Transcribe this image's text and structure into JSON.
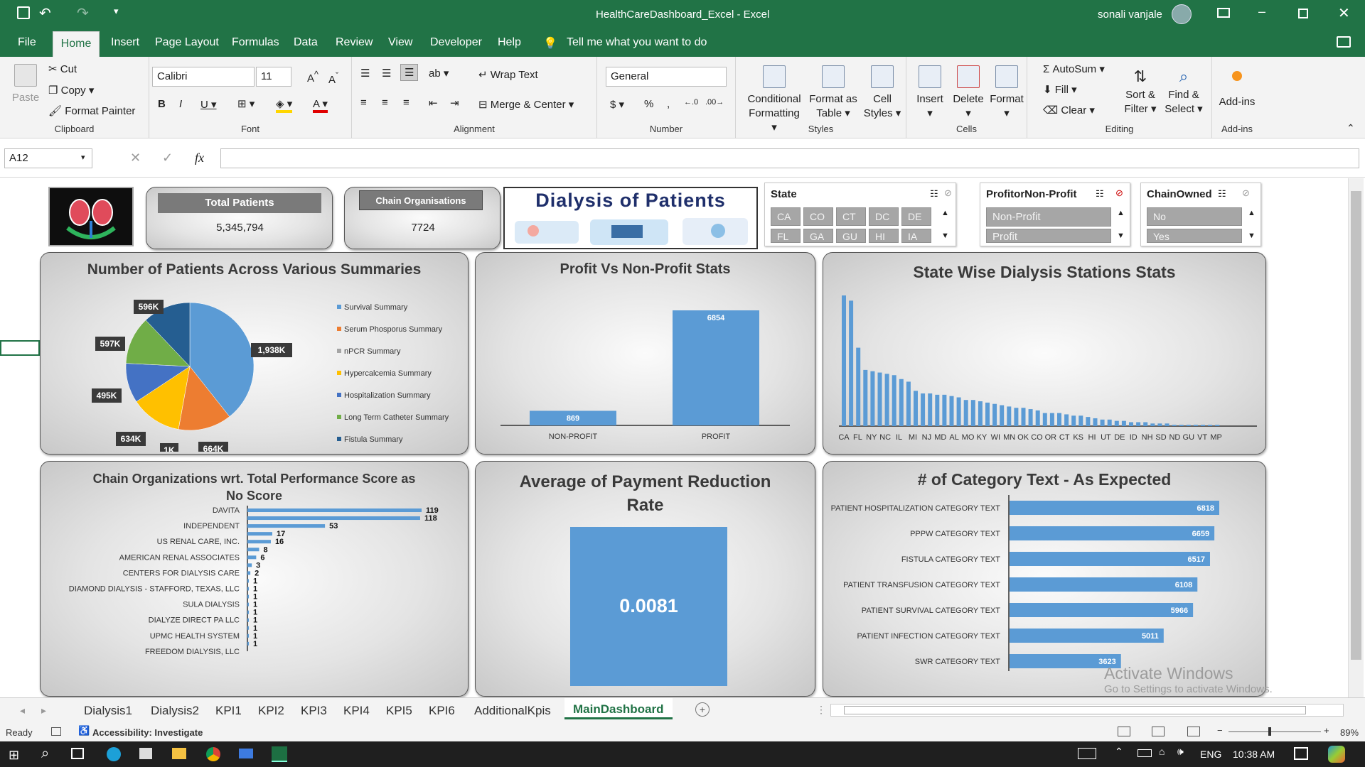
{
  "window": {
    "title": "HealthCareDashboard_Excel  -  Excel",
    "user": "sonali vanjale"
  },
  "menu": {
    "tabs": [
      "File",
      "Home",
      "Insert",
      "Page Layout",
      "Formulas",
      "Data",
      "Review",
      "View",
      "Developer",
      "Help"
    ],
    "tell_me": "Tell me what you want to do"
  },
  "ribbon": {
    "clipboard": {
      "paste": "Paste",
      "cut": "Cut",
      "copy": "Copy",
      "format_painter": "Format Painter",
      "label": "Clipboard"
    },
    "font": {
      "name": "Calibri",
      "size": "11",
      "label": "Font"
    },
    "alignment": {
      "wrap": "Wrap Text",
      "merge": "Merge & Center",
      "label": "Alignment"
    },
    "number": {
      "format": "General",
      "label": "Number"
    },
    "styles": {
      "cond_1": "Conditional",
      "cond_2": "Formatting",
      "fmt_1": "Format as",
      "fmt_2": "Table",
      "cell_1": "Cell",
      "cell_2": "Styles",
      "label": "Styles"
    },
    "cells": {
      "insert": "Insert",
      "delete": "Delete",
      "format": "Format",
      "label": "Cells"
    },
    "editing": {
      "autosum": "AutoSum",
      "fill": "Fill",
      "clear": "Clear",
      "sort_1": "Sort &",
      "sort_2": "Filter",
      "find_1": "Find &",
      "find_2": "Select",
      "label": "Editing"
    },
    "addins": {
      "btn": "Add-ins",
      "label": "Add-ins"
    }
  },
  "formula_bar": {
    "name_box": "A12",
    "fx": "fx",
    "value": ""
  },
  "dashboard": {
    "total_patients": {
      "label": "Total Patients",
      "value": "5,345,794"
    },
    "chain_orgs": {
      "label": "Chain Organisations",
      "value": "7724"
    },
    "banner_title": "Dialysis of Patients",
    "slicers": {
      "state": {
        "title": "State",
        "items": [
          "CA",
          "CO",
          "CT",
          "DC",
          "DE",
          "FL",
          "GA",
          "GU",
          "HI",
          "IA"
        ]
      },
      "profit": {
        "title": "ProfitorNon-Profit",
        "items": [
          "Non-Profit",
          "Profit"
        ]
      },
      "chain": {
        "title": "ChainOwned",
        "items": [
          "No",
          "Yes"
        ]
      }
    },
    "pie": {
      "title": "Number of Patients Across Various Summaries",
      "labels": [
        "1,938K",
        "664K",
        "1K",
        "634K",
        "495K",
        "597K",
        "596K"
      ]
    },
    "profit_chart": {
      "title": "Profit Vs Non-Profit Stats"
    },
    "state_chart": {
      "title": "State Wise Dialysis Stations Stats"
    },
    "chain_perf": {
      "title_1": "Chain Organizations wrt. Total Performance Score as",
      "title_2": "No Score"
    },
    "payment": {
      "title_1": "Average of Payment Reduction",
      "title_2": "Rate",
      "value": "0.0081"
    },
    "category": {
      "title": "# of Category Text  - As Expected"
    }
  },
  "chart_data": [
    {
      "type": "pie",
      "title": "Number of Patients Across Various Summaries",
      "categories": [
        "Survival Summary",
        "Serum Phosporus Summary",
        "nPCR Summary",
        "Hypercalcemia Summary",
        "Hospitalization Summary",
        "Long Term Catheter Summary",
        "Fistula Summary"
      ],
      "values": [
        1938,
        664,
        1,
        634,
        495,
        597,
        596
      ],
      "colors": [
        "#5b9bd5",
        "#ed7d31",
        "#a5a5a5",
        "#ffc000",
        "#4472c4",
        "#70ad47",
        "#255e91"
      ],
      "legend": "right"
    },
    {
      "type": "bar",
      "title": "Profit Vs Non-Profit Stats",
      "categories": [
        "NON-PROFIT",
        "PROFIT"
      ],
      "values": [
        869,
        6854
      ]
    },
    {
      "type": "bar",
      "title": "State Wise Dialysis Stations Stats",
      "categories": [
        "CA",
        "FL",
        "NY",
        "NC",
        "IL",
        "MI",
        "NJ",
        "MD",
        "AL",
        "MO",
        "KY",
        "WI",
        "MN",
        "OK",
        "CO",
        "OR",
        "CT",
        "KS",
        "HI",
        "UT",
        "DE",
        "ID",
        "NH",
        "SD",
        "ND",
        "GU",
        "VT",
        "MP"
      ],
      "values": [
        100,
        96,
        60,
        43,
        42,
        41,
        40,
        39,
        36,
        34,
        27,
        25,
        25,
        24,
        24,
        23,
        22,
        20,
        20,
        19,
        18,
        17,
        16,
        15,
        14,
        14,
        13,
        12,
        10,
        10,
        10,
        9,
        8,
        8,
        7,
        6,
        5,
        5,
        4,
        4,
        3,
        3,
        3,
        2,
        2,
        2,
        1,
        1,
        1,
        1,
        1,
        1,
        1
      ],
      "grid": false
    },
    {
      "type": "bar",
      "title": "Chain Organizations wrt. Total Performance Score as No Score",
      "categories": [
        "DAVITA",
        "INDEPENDENT",
        "US RENAL CARE, INC.",
        "AMERICAN RENAL ASSOCIATES",
        "CENTERS FOR DIALYSIS CARE",
        "DIAMOND DIALYSIS - STAFFORD, TEXAS, LLC",
        "SULA DIALYSIS",
        "DIALYZE DIRECT PA LLC",
        "UPMC HEALTH SYSTEM",
        "FREEDOM DIALYSIS, LLC"
      ],
      "values": [
        119,
        118,
        53,
        17,
        16,
        8,
        6,
        3,
        2,
        1,
        1,
        1,
        1,
        1,
        1,
        1,
        1,
        1
      ]
    },
    {
      "type": "bar",
      "title": "Average of Payment Reduction Rate",
      "categories": [
        ""
      ],
      "values": [
        0.0081
      ]
    },
    {
      "type": "bar",
      "title": "# of Category Text  - As Expected",
      "categories": [
        "PATIENT HOSPITALIZATION CATEGORY TEXT",
        "PPPW CATEGORY TEXT",
        "FISTULA CATEGORY TEXT",
        "PATIENT TRANSFUSION CATEGORY TEXT",
        "PATIENT SURVIVAL CATEGORY TEXT",
        "PATIENT INFECTION CATEGORY TEXT",
        "SWR CATEGORY TEXT"
      ],
      "values": [
        6818,
        6659,
        6517,
        6108,
        5966,
        5011,
        3623
      ]
    }
  ],
  "sheet_tabs": [
    "Dialysis1",
    "Dialysis2",
    "KPI1",
    "KPI2",
    "KPI3",
    "KPI4",
    "KPI5",
    "KPI6",
    "AdditionalKpis",
    "MainDashboard"
  ],
  "watermark": {
    "line1": "Activate Windows",
    "line2": "Go to Settings to activate Windows."
  },
  "status": {
    "ready": "Ready",
    "accessibility": "Accessibility: Investigate",
    "zoom": "89%"
  },
  "taskbar": {
    "lang": "ENG",
    "time": "10:38 AM"
  }
}
